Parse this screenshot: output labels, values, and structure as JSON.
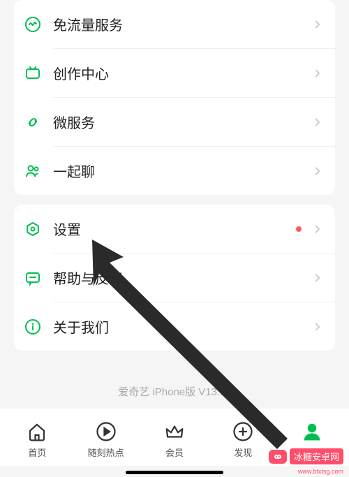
{
  "list1": {
    "items": [
      {
        "id": "free-data",
        "label": "免流量服务",
        "iconColor": "#00be50"
      },
      {
        "id": "creator-center",
        "label": "创作中心",
        "iconColor": "#00be50"
      },
      {
        "id": "micro-service",
        "label": "微服务",
        "iconColor": "#00be50"
      },
      {
        "id": "chat-together",
        "label": "一起聊",
        "iconColor": "#00be50"
      }
    ]
  },
  "list2": {
    "items": [
      {
        "id": "settings",
        "label": "设置",
        "iconColor": "#00be50",
        "dot": true
      },
      {
        "id": "help-feedback",
        "label": "帮助与反馈",
        "iconColor": "#00be50"
      },
      {
        "id": "about-us",
        "label": "关于我们",
        "iconColor": "#00be50"
      }
    ]
  },
  "version": "爱奇艺 iPhone版 V13.11",
  "tabs": [
    {
      "id": "home",
      "label": "首页"
    },
    {
      "id": "hot",
      "label": "随刻热点"
    },
    {
      "id": "vip",
      "label": "会员"
    },
    {
      "id": "discover",
      "label": "发现"
    },
    {
      "id": "mine",
      "label": "我的",
      "active": true
    }
  ],
  "watermark": {
    "text": "冰糖安卓网",
    "url": "www.btxtsg.com"
  },
  "colors": {
    "accent": "#00be50"
  }
}
